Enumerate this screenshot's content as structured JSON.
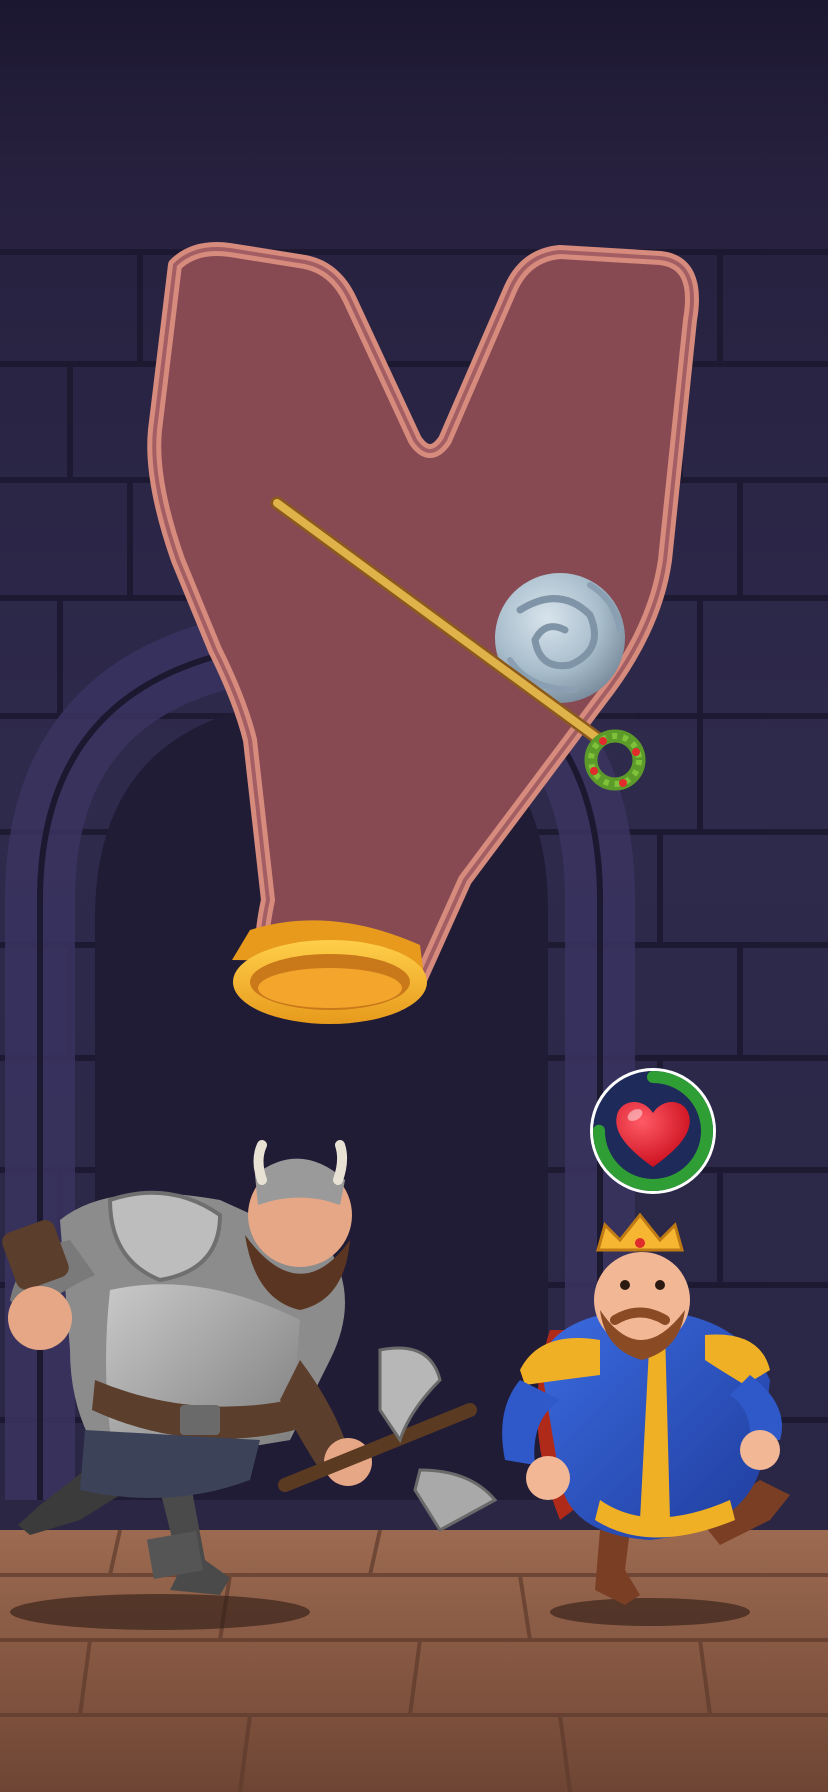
{
  "level": {
    "elements": {
      "container": "y-shaped-tube",
      "pin": "pull-pin",
      "pin_handle": "wreath-ring-handle",
      "obstacle": "stone-ball",
      "exit": "golden-ring-outlet"
    }
  },
  "characters": {
    "enemy": {
      "icon": "viking-warrior-with-axe"
    },
    "hero": {
      "icon": "king-with-crown"
    }
  },
  "hud": {
    "life_meter": {
      "icon": "heart-icon",
      "progress": 0.75
    }
  },
  "colors": {
    "wall": "#2c2748",
    "floor": "#8d5d46",
    "tube_fill": "#874a53",
    "tube_border": "#d68b7d",
    "pin": "#e0b24a",
    "ring_gold": "#f6b631",
    "heart": "#e01024",
    "meter_ring": "#2f9e35"
  }
}
